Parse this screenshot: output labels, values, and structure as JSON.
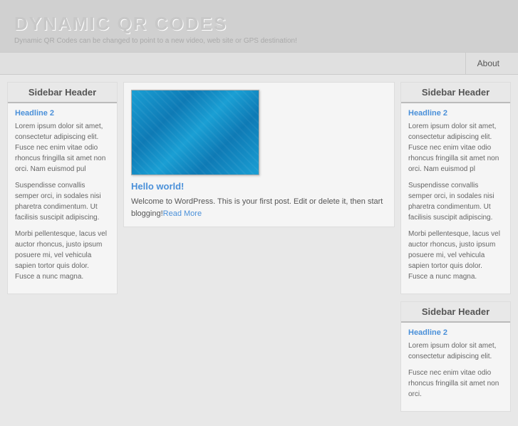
{
  "header": {
    "title": "DYNAMIC QR CODES",
    "subtitle": "Dynamic QR Codes can be changed to point to a new video, web site or GPS destination!"
  },
  "navbar": {
    "items": [
      {
        "label": "About"
      }
    ]
  },
  "left_sidebar": {
    "boxes": [
      {
        "header": "Sidebar Header",
        "headline": "Headline 2",
        "paragraphs": [
          "Lorem ipsum dolor sit amet, consectetur adipiscing elit. Fusce nec enim vitae odio rhoncus fringilla sit amet non orci. Nam euismod pul",
          "Suspendisse convallis semper orci, in sodales nisi pharetra condimentum. Ut facilisis suscipit adipiscing.",
          "Morbi pellentesque, lacus vel auctor rhoncus, justo ipsum posuere mi, vel vehicula sapien tortor quis dolor. Fusce a nunc magna."
        ]
      }
    ]
  },
  "center": {
    "post_title": "Hello world!",
    "post_body": "Welcome to WordPress. This is your first post. Edit or delete it, then start blogging!",
    "read_more": "Read More"
  },
  "right_sidebar": {
    "boxes": [
      {
        "header": "Sidebar Header",
        "headline": "Headline 2",
        "paragraphs": [
          "Lorem ipsum dolor sit amet, consectetur adipiscing elit. Fusce nec enim vitae odio rhoncus fringilla sit amet non orci. Nam euismod pl",
          "Suspendisse convallis semper orci, in sodales nisi pharetra condimentum. Ut facilisis suscipit adipiscing.",
          "Morbi pellentesque, lacus vel auctor rhoncus, justo ipsum posuere mi, vel vehicula sapien tortor quis dolor. Fusce a nunc magna."
        ]
      },
      {
        "header": "Sidebar Header",
        "headline": "Headline 2",
        "paragraphs": [
          "Lorem ipsum dolor sit amet, consectetur adipiscing elit.",
          "Fusce nec enim vitae odio rhoncus fringilla sit amet non orci."
        ]
      }
    ]
  }
}
